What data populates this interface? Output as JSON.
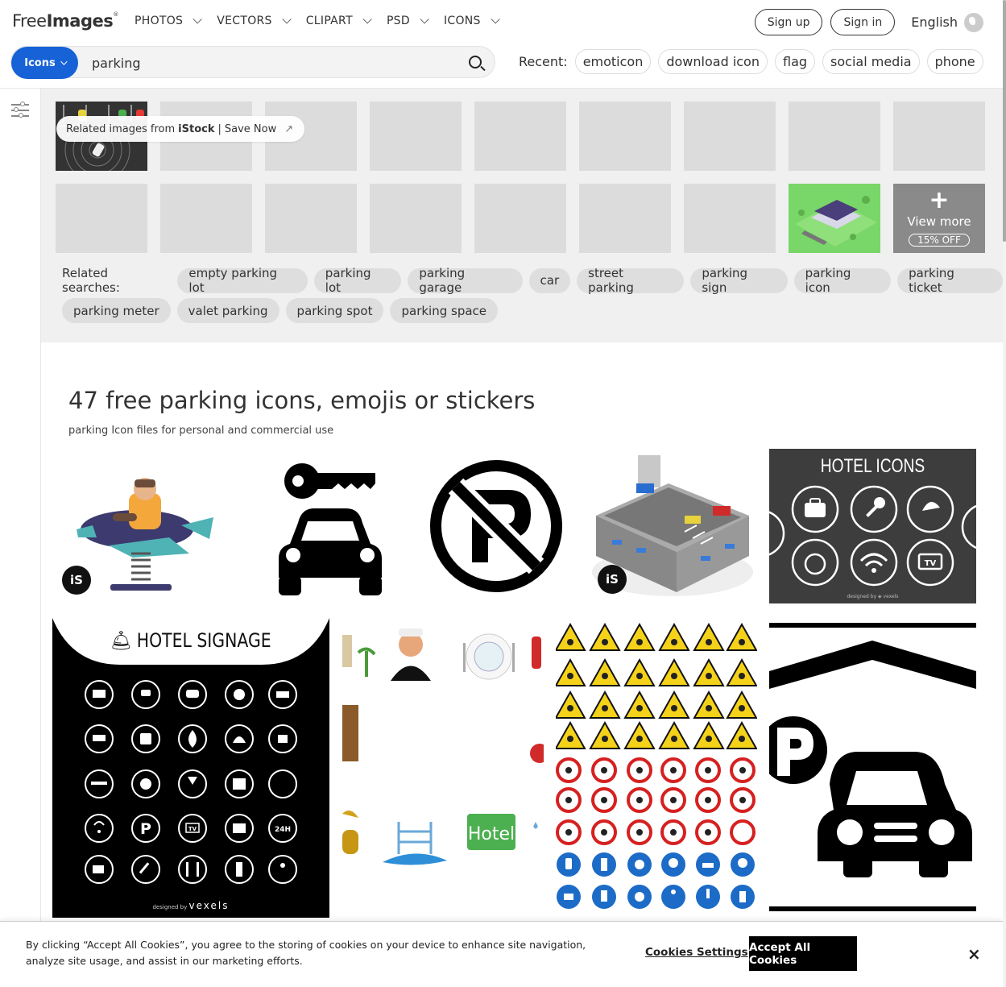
{
  "logo": {
    "text_light": "Free",
    "text_bold": "Images",
    "mark": "®"
  },
  "nav": [
    {
      "label": "PHOTOS",
      "has_dropdown": true
    },
    {
      "label": "VECTORS",
      "has_dropdown": true
    },
    {
      "label": "CLIPART",
      "has_dropdown": true
    },
    {
      "label": "PSD",
      "has_dropdown": true
    },
    {
      "label": "ICONS",
      "has_dropdown": true
    }
  ],
  "auth": {
    "signup": "Sign up",
    "signin": "Sign in",
    "language": "English"
  },
  "search": {
    "type": "Icons",
    "value": "parking"
  },
  "recent": {
    "label": "Recent:",
    "items": [
      "emoticon",
      "download icon",
      "flag",
      "social media",
      "phone"
    ]
  },
  "istock": {
    "prefix": "Related images from",
    "brand": "iStock",
    "divider": "|",
    "cta": "Save Now",
    "cta_icon": "external-arrow-icon"
  },
  "view_more": {
    "plus": "+",
    "label": "View more",
    "badge": "15% OFF"
  },
  "related_searches": {
    "label": "Related searches:",
    "row1": [
      "empty parking lot",
      "parking lot",
      "parking garage",
      "car",
      "street parking",
      "parking sign",
      "parking icon",
      "parking ticket"
    ],
    "row2": [
      "parking meter",
      "valet parking",
      "parking spot",
      "parking space"
    ]
  },
  "results": {
    "title": "47 free parking icons, emojis or stickers",
    "subtitle": "parking Icon files for personal and commercial use"
  },
  "cards": {
    "istock_badge": "iS",
    "hotel_icons_title": "HOTEL ICONS",
    "hotel_icons_credit": "designed by ◈ vexels",
    "hotel_signage_title": "HOTEL SIGNAGE",
    "hotel_signage_credit_small": "designed by",
    "hotel_signage_credit_brand": "vexels",
    "hotel_sign_text": "Hotel",
    "parking_letter": "P",
    "tv_label": "TV",
    "h24": "24H"
  },
  "cookie": {
    "text": "By clicking “Accept All Cookies”, you agree to the storing of cookies on your device to enhance site navigation, analyze site usage, and assist in our marketing efforts.",
    "settings": "Cookies Settings",
    "accept": "Accept All Cookies",
    "close": "×"
  },
  "colors": {
    "accent": "#1662d6",
    "chip_bg": "#dedede",
    "panel_bg": "#f0f0f0"
  }
}
